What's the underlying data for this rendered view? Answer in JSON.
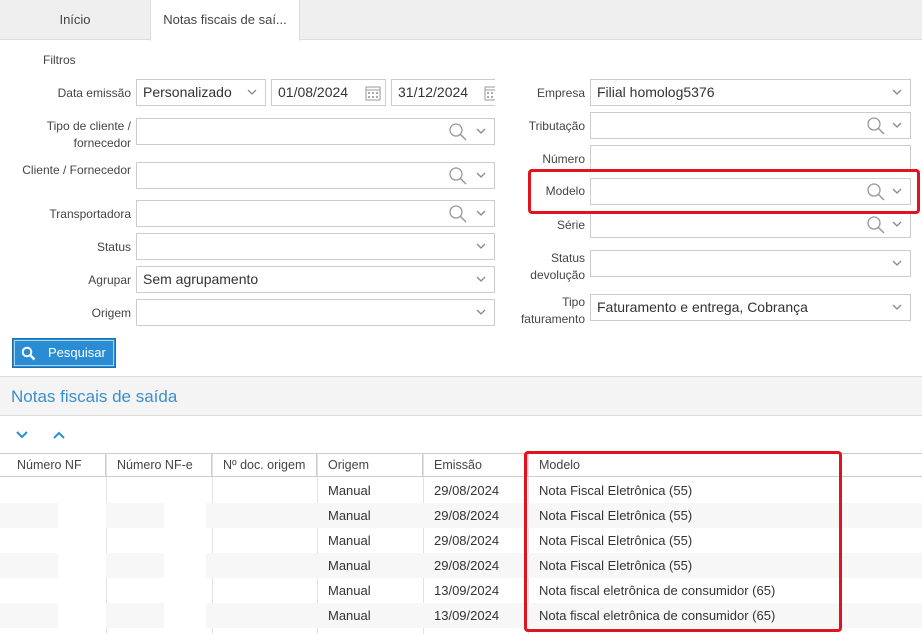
{
  "tabs": [
    {
      "label": "Início"
    },
    {
      "label": "Notas fiscais de saí..."
    }
  ],
  "filters": {
    "title": "Filtros",
    "data_emissao": {
      "label": "Data emissão",
      "mode": "Personalizado",
      "from": "01/08/2024",
      "to": "31/12/2024"
    },
    "tipo_cliente": {
      "label": "Tipo de cliente / fornecedor",
      "value": ""
    },
    "cliente": {
      "label": "Cliente / Fornecedor",
      "value": ""
    },
    "transportadora": {
      "label": "Transportadora",
      "value": ""
    },
    "status": {
      "label": "Status",
      "value": ""
    },
    "agrupar": {
      "label": "Agrupar",
      "value": "Sem agrupamento"
    },
    "origem": {
      "label": "Origem",
      "value": ""
    },
    "empresa": {
      "label": "Empresa",
      "value": "Filial homolog5376"
    },
    "tributacao": {
      "label": "Tributação",
      "value": ""
    },
    "numero": {
      "label": "Número",
      "value": ""
    },
    "modelo": {
      "label": "Modelo",
      "value": ""
    },
    "serie": {
      "label": "Série",
      "value": ""
    },
    "status_devolucao": {
      "label": "Status devolução",
      "value": ""
    },
    "tipo_faturamento": {
      "label": "Tipo faturamento",
      "value": "Faturamento e entrega, Cobrança"
    }
  },
  "search_button": {
    "label": "Pesquisar"
  },
  "section": {
    "title": "Notas fiscais de saída"
  },
  "table": {
    "columns": [
      "Número NF",
      "Número NF-e",
      "Nº doc. origem",
      "Origem",
      "Emissão",
      "Modelo"
    ],
    "rows": [
      {
        "origem": "Manual",
        "emissao": "29/08/2024",
        "modelo": "Nota Fiscal Eletrônica (55)"
      },
      {
        "origem": "Manual",
        "emissao": "29/08/2024",
        "modelo": "Nota Fiscal Eletrônica (55)"
      },
      {
        "origem": "Manual",
        "emissao": "29/08/2024",
        "modelo": "Nota Fiscal Eletrônica (55)"
      },
      {
        "origem": "Manual",
        "emissao": "29/08/2024",
        "modelo": "Nota Fiscal Eletrônica (55)"
      },
      {
        "origem": "Manual",
        "emissao": "13/09/2024",
        "modelo": "Nota fiscal eletrônica de consumidor (65)"
      },
      {
        "origem": "Manual",
        "emissao": "13/09/2024",
        "modelo": "Nota fiscal eletrônica de consumidor (65)"
      }
    ]
  },
  "colors": {
    "accent": "#2a8dd4",
    "highlight": "#e0141e",
    "title_blue": "#3a8fcb"
  }
}
